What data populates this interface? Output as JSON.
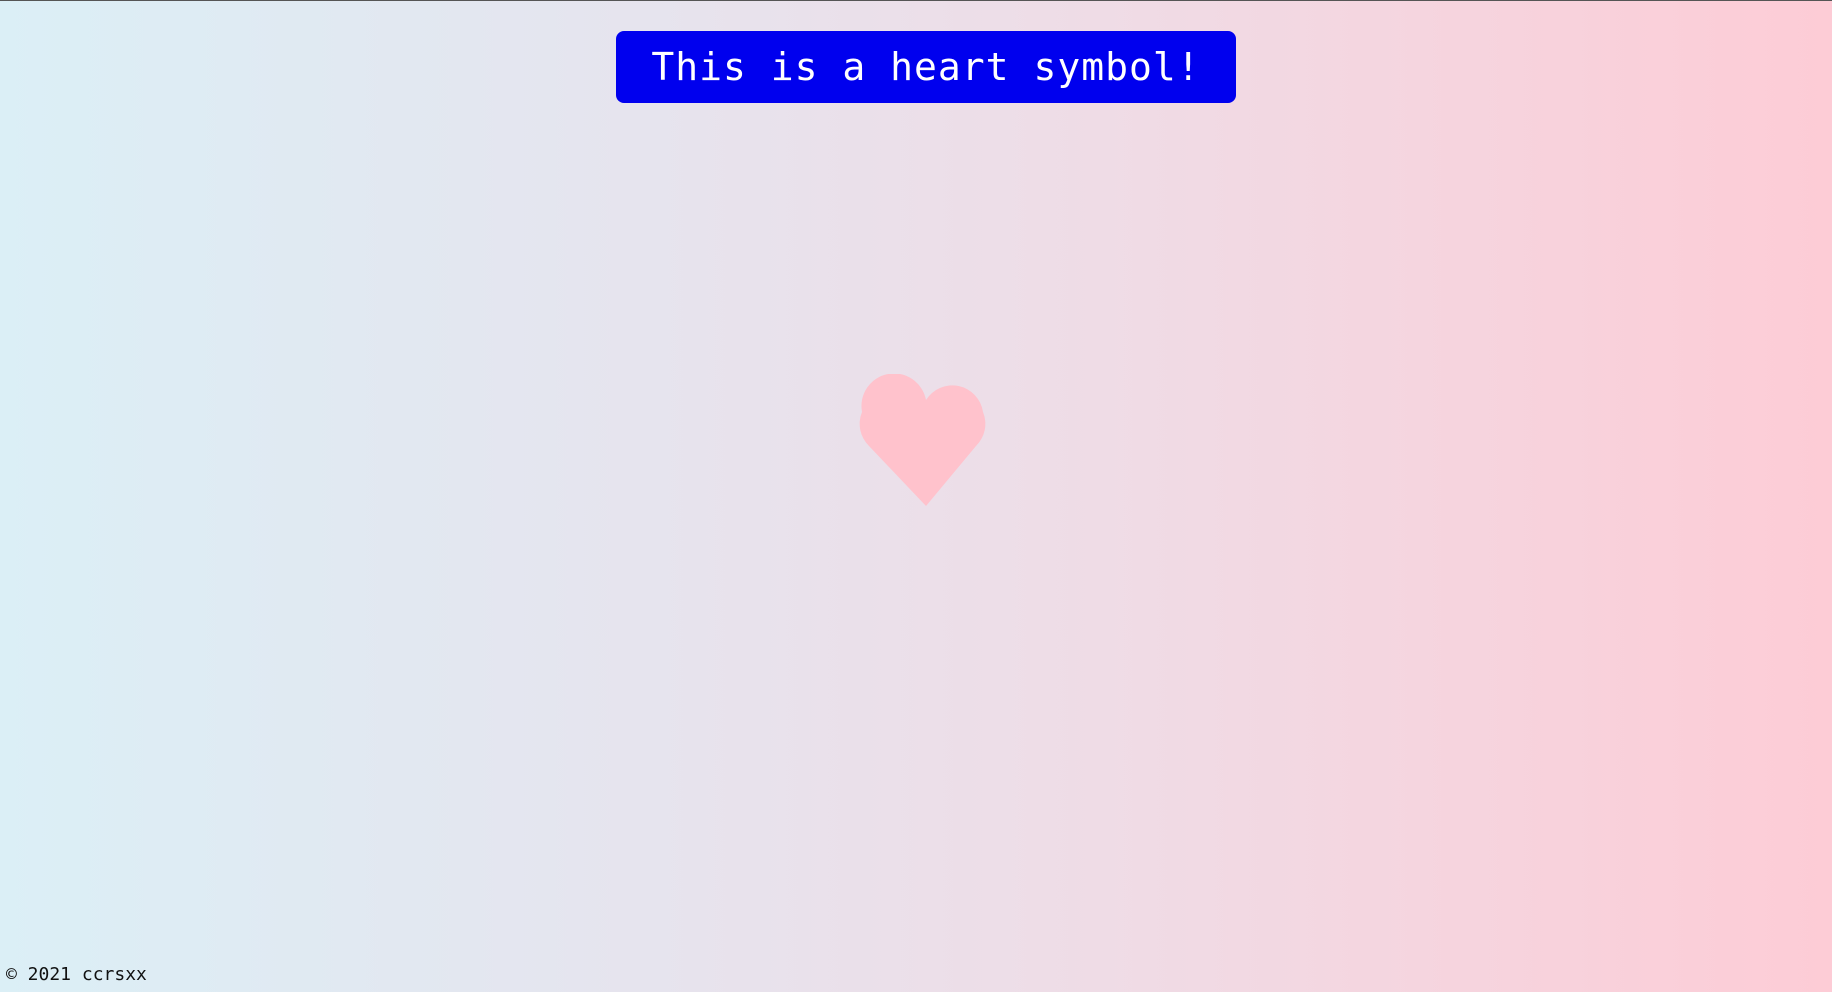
{
  "banner": {
    "text": "This is a heart symbol!"
  },
  "heart": {
    "icon": "heart-icon",
    "color": "#ffc2cc"
  },
  "footer": {
    "copyright": "© 2021 ccrsxx"
  },
  "colors": {
    "banner_background": "#0000ee",
    "banner_text": "#ffffff",
    "gradient_left": "#dbeff6",
    "gradient_right": "#fdccd6"
  }
}
